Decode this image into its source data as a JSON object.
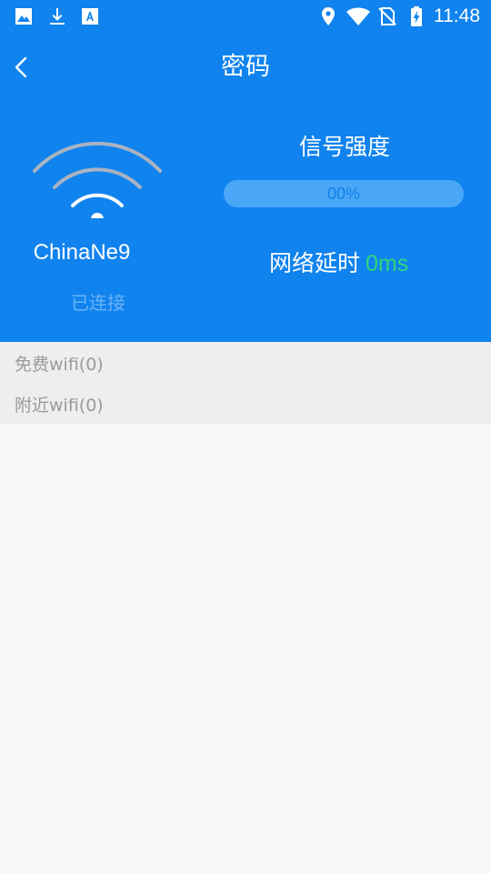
{
  "status_bar": {
    "time": "11:48",
    "icons": [
      "image-icon",
      "download-icon",
      "font-a-icon",
      "location-icon",
      "wifi-icon",
      "no-sim-icon",
      "battery-charging-icon"
    ]
  },
  "app_bar": {
    "back_icon": "back-chevron-icon",
    "title": "密码"
  },
  "network": {
    "wifi_icon": "wifi-icon",
    "ssid": "ChinaNe9",
    "status": "已连接"
  },
  "signal": {
    "label": "信号强度",
    "percent_text": "00%",
    "percent_value": 0
  },
  "latency": {
    "label": "网络延时",
    "value": "0ms"
  },
  "lists": {
    "free_wifi": "免费wifi(0)",
    "nearby_wifi": "附近wifi(0)"
  },
  "colors": {
    "primary": "#1083ee",
    "latency_value": "#2ed67a",
    "section_bg": "#eeeeee",
    "body_bg": "#f8f8f8"
  }
}
